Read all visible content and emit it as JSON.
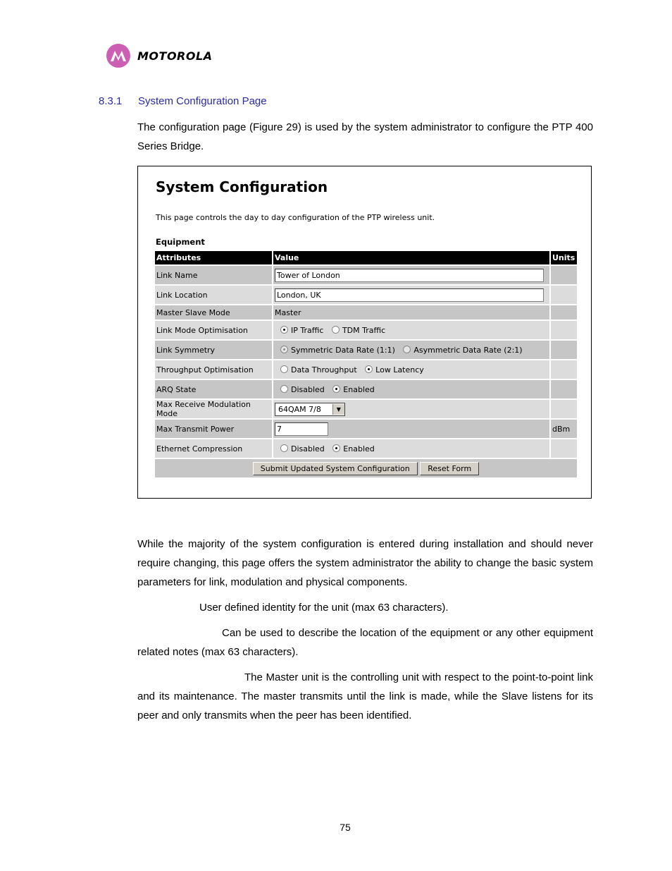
{
  "header": {
    "brand": "MOTOROLA",
    "logo_color": "#cc5fb4"
  },
  "section": {
    "number": "8.3.1",
    "title": "System Configuration Page",
    "color": "#2a2aa8"
  },
  "intro": "The configuration page (Figure 29) is used by the system administrator to configure the PTP 400 Series Bridge.",
  "figure": {
    "title": "System Configuration",
    "description": "This page controls the day to day configuration of the PTP wireless unit.",
    "subtitle": "Equipment",
    "columns": [
      "Attributes",
      "Value",
      "Units"
    ],
    "rows": {
      "link_name": {
        "label": "Link Name",
        "value": "Tower of London",
        "units": ""
      },
      "link_location": {
        "label": "Link Location",
        "value": "London, UK",
        "units": ""
      },
      "master_slave": {
        "label": "Master Slave Mode",
        "value": "Master",
        "units": ""
      },
      "link_mode": {
        "label": "Link Mode Optimisation",
        "options": [
          "IP Traffic",
          "TDM Traffic"
        ],
        "selected": "IP Traffic"
      },
      "link_symmetry": {
        "label": "Link Symmetry",
        "options": [
          "Symmetric Data Rate (1:1)",
          "Asymmetric Data Rate (2:1)"
        ],
        "selected": "Symmetric Data Rate (1:1)"
      },
      "throughput": {
        "label": "Throughput Optimisation",
        "options": [
          "Data Throughput",
          "Low Latency"
        ],
        "selected": "Low Latency"
      },
      "arq": {
        "label": "ARQ State",
        "options": [
          "Disabled",
          "Enabled"
        ],
        "selected": "Enabled"
      },
      "modulation": {
        "label": "Max Receive Modulation Mode",
        "value": "64QAM 7/8"
      },
      "tx_power": {
        "label": "Max Transmit Power",
        "value": "7",
        "units": "dBm"
      },
      "ethernet": {
        "label": "Ethernet Compression",
        "options": [
          "Disabled",
          "Enabled"
        ],
        "selected": "Enabled"
      }
    },
    "buttons": {
      "submit": "Submit Updated System Configuration",
      "reset": "Reset Form"
    }
  },
  "body": {
    "p1": "While the majority of the system configuration is entered during installation and should never require changing, this page offers the system administrator the ability to change the basic system parameters for link, modulation and physical components.",
    "p2": "User defined identity for the unit (max 63 characters).",
    "p3": "Can be used to describe the location of the equipment or any other equipment related notes (max 63 characters).",
    "p4": "The Master unit is the controlling unit with respect to the point-to-point link and its maintenance. The master transmits until the link is made, while the Slave listens for its peer and only transmits when the peer has been identified."
  },
  "page_number": "75"
}
